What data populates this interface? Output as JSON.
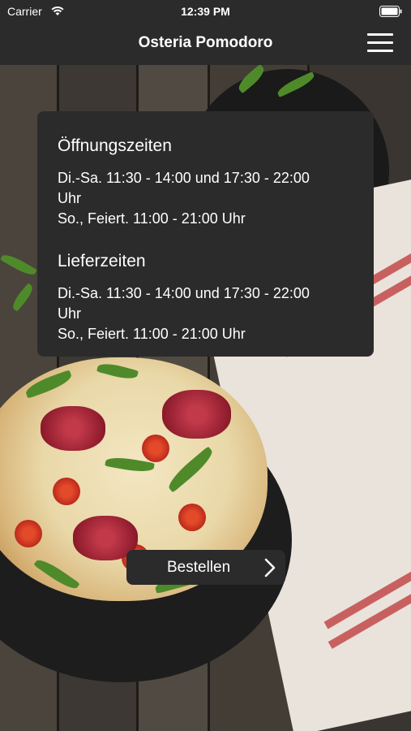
{
  "status_bar": {
    "carrier": "Carrier",
    "time": "12:39 PM",
    "wifi_icon": "wifi-icon",
    "battery_icon": "battery-icon"
  },
  "nav_bar": {
    "title": "Osteria Pomodoro",
    "menu_icon": "hamburger-menu-icon"
  },
  "info_card": {
    "opening_hours": {
      "title": "Öffnungszeiten",
      "lines": [
        "Di.-Sa. 11:30 - 14:00 und 17:30 - 22:00",
        "Uhr",
        "So., Feiert. 11:00 - 21:00 Uhr"
      ]
    },
    "delivery_hours": {
      "title": "Lieferzeiten",
      "lines": [
        "Di.-Sa. 11:30 - 14:00 und 17:30 - 22:00",
        "Uhr",
        "So., Feiert. 11:00 - 21:00 Uhr"
      ]
    }
  },
  "order_button": {
    "label": "Bestellen",
    "icon": "chevron-right-icon"
  },
  "colors": {
    "bar_background": "#2b2b2b",
    "card_background": "#2b2b2b",
    "text": "#ffffff"
  }
}
